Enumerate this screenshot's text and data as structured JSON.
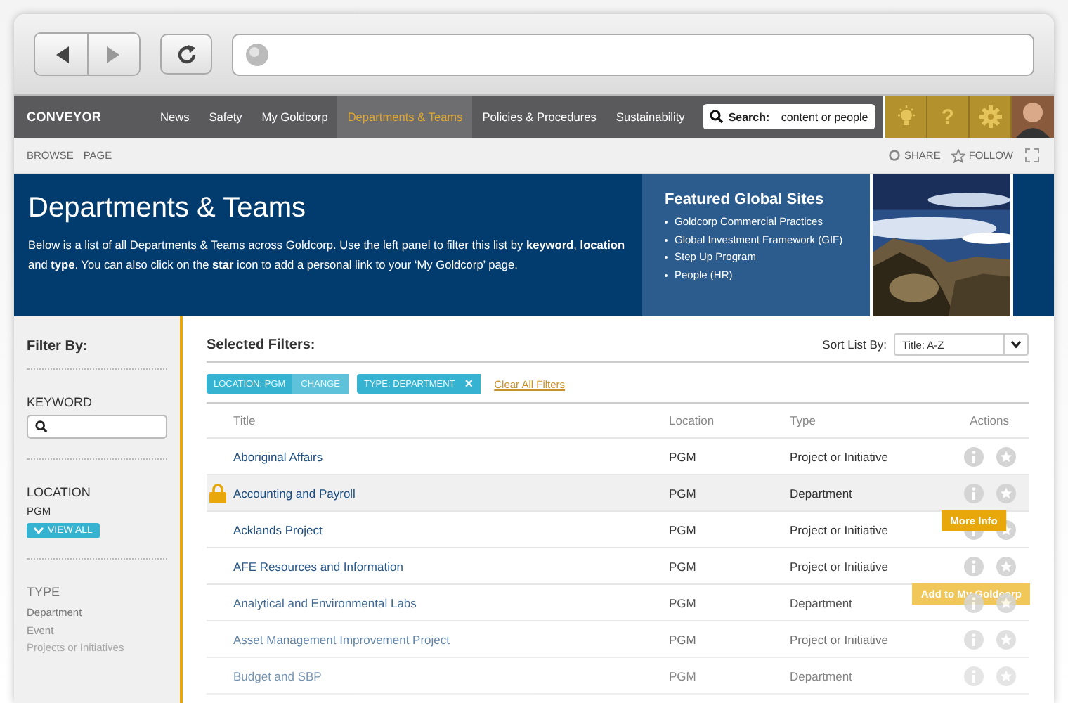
{
  "nav": {
    "logo": "CONVEYOR",
    "items": [
      {
        "label": "News",
        "selected": false
      },
      {
        "label": "Safety",
        "selected": false
      },
      {
        "label": "My Goldcorp",
        "selected": false
      },
      {
        "label": "Departments & Teams",
        "selected": true
      },
      {
        "label": "Policies & Procedures",
        "selected": false
      },
      {
        "label": "Sustainability",
        "selected": false
      }
    ],
    "search": {
      "label": "Search:",
      "placeholder": "content or people"
    },
    "help_label": "?"
  },
  "subbar": {
    "links": [
      "BROWSE",
      "PAGE"
    ],
    "actions": [
      "SHARE",
      "FOLLOW"
    ]
  },
  "banner": {
    "title": "Departments & Teams",
    "text": "Below is a list of all Departments & Teams across Goldcorp. Use the left panel to filter this list by **keyword**, **location** and **type**. You can also click on the **star** icon to add a personal link to your ‘My Goldcorp’ page.",
    "featured": {
      "title": "Featured Global Sites",
      "links": [
        "Goldcorp Commercial Practices",
        "Global Investment Framework (GIF)",
        "Step Up Program",
        "People (HR)"
      ]
    }
  },
  "sidebar": {
    "title": "Filter By:",
    "keyword": {
      "label": "KEYWORD"
    },
    "location": {
      "label": "LOCATION",
      "value": "PGM",
      "button": "VIEW ALL"
    },
    "type": {
      "label": "TYPE",
      "items": [
        "Department",
        "Event",
        "Projects or Initiatives"
      ]
    }
  },
  "filters": {
    "title": "Selected Filters:",
    "sort_label": "Sort List By:",
    "sort_value": "Title: A-Z",
    "chips": [
      {
        "label": "LOCATION: PGM",
        "action": "CHANGE"
      },
      {
        "label": "TYPE: DEPARTMENT",
        "action": "×"
      }
    ],
    "clear": "Clear All Filters"
  },
  "table": {
    "columns": [
      "Title",
      "Location",
      "Type",
      "Actions"
    ],
    "rows": [
      {
        "title": "Aboriginal Affairs",
        "location": "PGM",
        "type": "Project or Initiative",
        "locked": false,
        "highlighted": false
      },
      {
        "title": "Accounting and Payroll",
        "location": "PGM",
        "type": "Department",
        "locked": true,
        "highlighted": true,
        "info_tooltip": "More Info"
      },
      {
        "title": "Acklands Project",
        "location": "PGM",
        "type": "Project or Initiative",
        "locked": false,
        "highlighted": false
      },
      {
        "title": "AFE Resources and Information",
        "location": "PGM",
        "type": "Project or Initiative",
        "locked": false,
        "highlighted": false,
        "star_tooltip": "Add to My Goldcorp"
      },
      {
        "title": "Analytical and Environmental Labs",
        "location": "PGM",
        "type": "Department",
        "locked": false,
        "highlighted": false
      },
      {
        "title": "Asset Management Improvement Project",
        "location": "PGM",
        "type": "Project or Initiative",
        "locked": false,
        "highlighted": false
      },
      {
        "title": "Budget and SBP",
        "location": "PGM",
        "type": "Department",
        "locked": false,
        "highlighted": false
      }
    ]
  }
}
